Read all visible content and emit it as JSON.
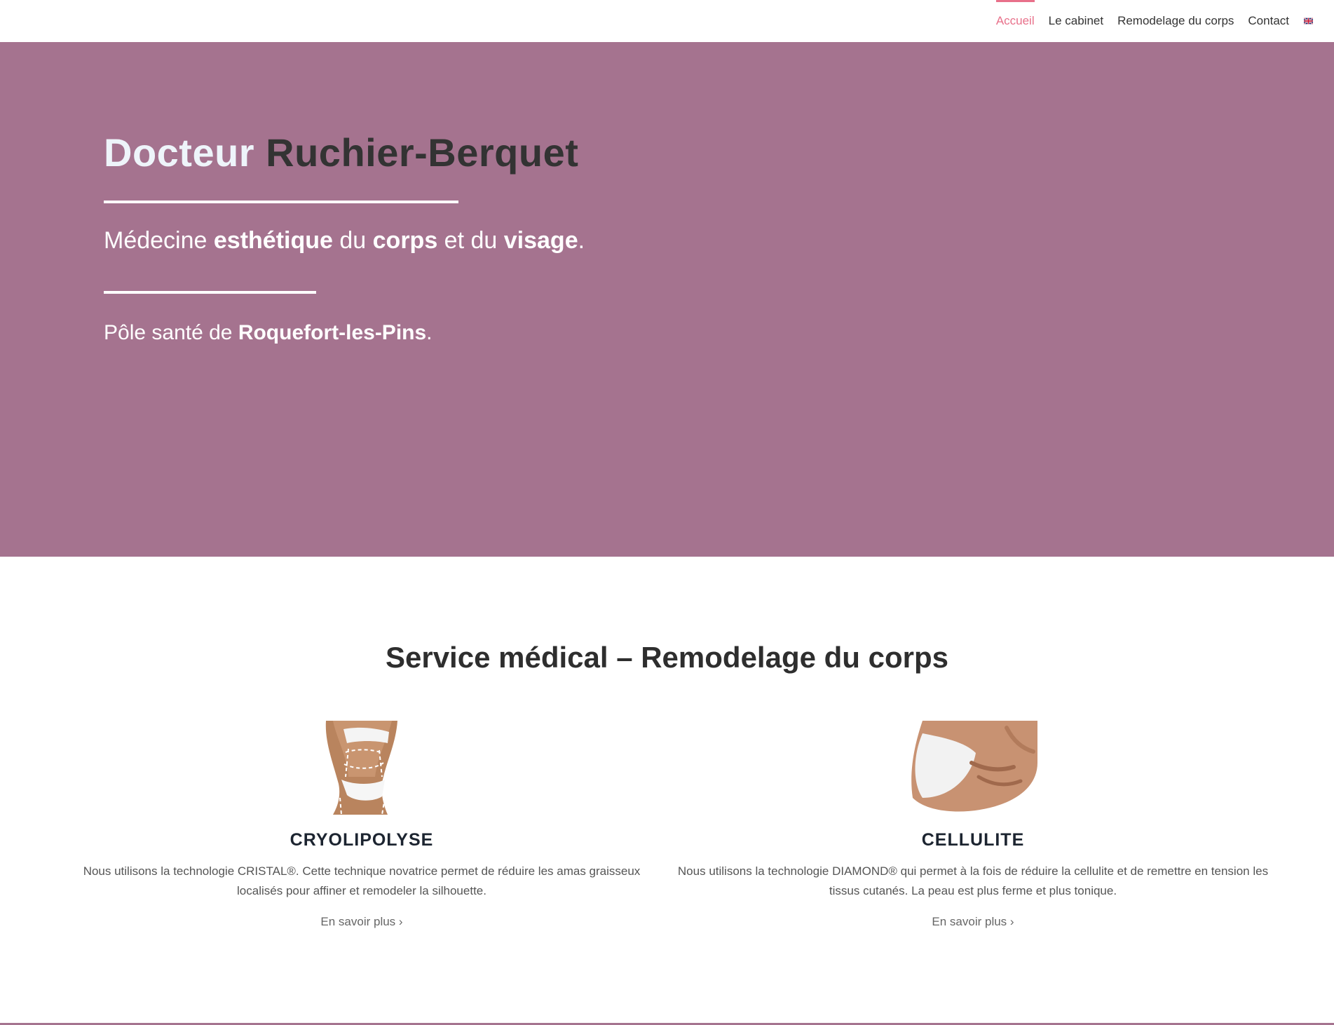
{
  "nav": {
    "items": [
      {
        "label": "Accueil",
        "active": true
      },
      {
        "label": "Le cabinet",
        "active": false
      },
      {
        "label": "Remodelage du corps",
        "active": false
      },
      {
        "label": "Contact",
        "active": false
      }
    ],
    "language_icon": "uk-flag-icon"
  },
  "hero": {
    "title_first": "Docteur",
    "title_rest": "Ruchier-Berquet",
    "subtitle": {
      "p1": "Médecine ",
      "b1": "esthétique",
      "p2": " du ",
      "b2": "corps",
      "p3": " et du ",
      "b3": "visage",
      "p4": "."
    },
    "location": {
      "p1": "Pôle santé de ",
      "b1": "Roquefort-les-Pins",
      "p2": "."
    },
    "background_color": "#a5738f"
  },
  "services": {
    "title": "Service médical – Remodelage du corps",
    "items": [
      {
        "title": "CRYOLIPOLYSE",
        "description": "Nous utilisons la technologie CRISTAL®. Cette technique novatrice permet de réduire les amas graisseux localisés pour affiner et remodeler la silhouette.",
        "link": "En savoir plus ›"
      },
      {
        "title": "CELLULITE",
        "description": "Nous utilisons la technologie DIAMOND® qui permet à la fois de réduire la cellulite et de remettre en tension les tissus cutanés. La peau est plus ferme et plus tonique.",
        "link": "En savoir plus ›"
      }
    ]
  },
  "colors": {
    "accent": "#e8708a",
    "hero": "#a5738f",
    "heading": "#2e2e2e"
  }
}
